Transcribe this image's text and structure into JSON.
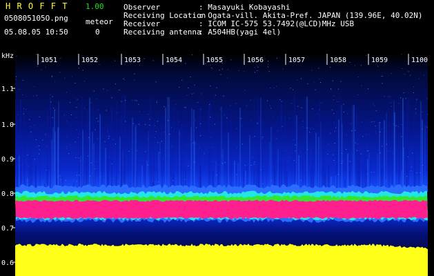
{
  "app": {
    "logo": "H R O F F T",
    "version": "1.00",
    "filename": "050805105O.png",
    "datetime": "05.08.05 10:50",
    "meteor_label": "meteor",
    "meteor_count": "0"
  },
  "info": {
    "rows": [
      {
        "label": "Observer",
        "value": ": Masayuki Kobayashi"
      },
      {
        "label": "Receiving Location",
        "value": ": Ogata-vill. Akita-Pref. JAPAN (139.96E, 40.02N)"
      },
      {
        "label": "Receiver",
        "value": ": ICOM IC-575 53.7492(@LCD)MHz USB"
      },
      {
        "label": "Receiving antenna",
        "value": ": A504HB(yagi 4el)"
      }
    ]
  },
  "spectrogram": {
    "y_unit": "kHz",
    "y_ticks": [
      "1.1",
      "1.0",
      "0.9",
      "0.8",
      "0.7",
      "0.6"
    ],
    "x_ticks": [
      "1051",
      "1052",
      "1053",
      "1054",
      "1055",
      "1056",
      "1057",
      "1058",
      "1059",
      "1100"
    ],
    "colors": {
      "background": "#000000",
      "noise": "#0a1aa8",
      "noise_bright": "#2a6cff",
      "band_cyan": "#22e6e6",
      "band_green": "#33e633",
      "band_magenta": "#ff1f8f",
      "floor_yellow": "#ffff1a"
    }
  }
}
